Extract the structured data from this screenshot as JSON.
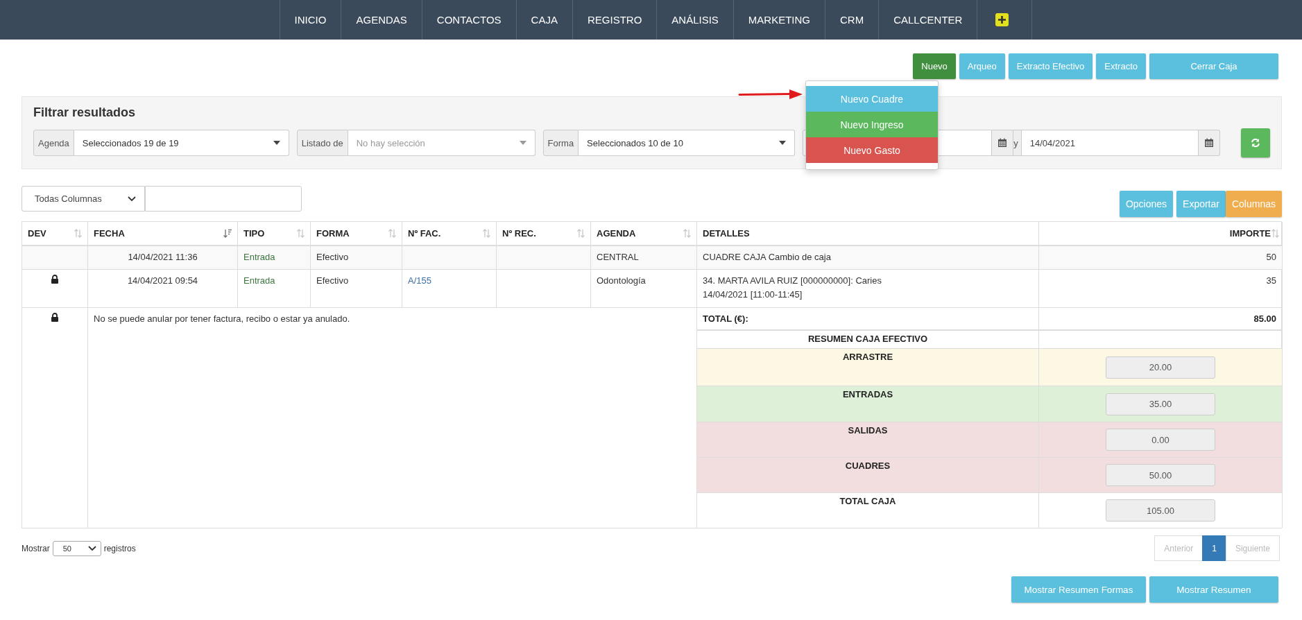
{
  "nav": {
    "items": [
      "INICIO",
      "AGENDAS",
      "CONTACTOS",
      "CAJA",
      "REGISTRO",
      "ANÁLISIS",
      "MARKETING",
      "CRM",
      "CALLCENTER"
    ]
  },
  "actions": [
    {
      "label": "Nuevo",
      "kind": "success"
    },
    {
      "label": "Arqueo",
      "kind": "info"
    },
    {
      "label": "Extracto Efectivo",
      "kind": "info"
    },
    {
      "label": "Extracto",
      "kind": "info"
    },
    {
      "label": "Cerrar Caja",
      "kind": "info"
    }
  ],
  "new_menu": [
    {
      "label": "Nuevo Cuadre",
      "kind": "info"
    },
    {
      "label": "Nuevo Ingreso",
      "kind": "success"
    },
    {
      "label": "Nuevo Gasto",
      "kind": "danger"
    }
  ],
  "filter": {
    "title": "Filtrar resultados",
    "selects": [
      {
        "addon": "Agenda",
        "value": "Seleccionados 19 de 19"
      },
      {
        "addon": "Listado de",
        "placeholder": "No hay selección"
      },
      {
        "addon": "Forma",
        "value": "Seleccionados 10 de 10"
      }
    ],
    "date_range": {
      "separator": "y",
      "end": "14/04/2021"
    }
  },
  "toolbar": {
    "column_select": "Todas Columnas",
    "buttons": [
      {
        "label": "Opciones",
        "kind": "info"
      },
      {
        "label": "Exportar",
        "kind": "info"
      },
      {
        "label": "Columnas",
        "kind": "warning"
      }
    ]
  },
  "table": {
    "columns": [
      {
        "label": "DEV",
        "kind": "sortable"
      },
      {
        "label": "FECHA",
        "kind": "sorted"
      },
      {
        "label": "TIPO",
        "kind": "sortable"
      },
      {
        "label": "FORMA",
        "kind": "sortable"
      },
      {
        "label": "Nº FAC.",
        "kind": "sortable"
      },
      {
        "label": "Nº REC.",
        "kind": "sortable"
      },
      {
        "label": "AGENDA",
        "kind": "sortable"
      },
      {
        "label": "DETALLES",
        "kind": "plain"
      },
      {
        "label": "IMPORTE",
        "kind": "sortable"
      }
    ],
    "rows": [
      {
        "locked": false,
        "fecha": "14/04/2021 11:36",
        "tipo": "Entrada",
        "forma": "Efectivo",
        "agenda": "CENTRAL",
        "detalles": [
          "CUADRE CAJA Cambio de caja"
        ],
        "importe": "50"
      },
      {
        "locked": true,
        "fecha": "14/04/2021 09:54",
        "tipo": "Entrada",
        "forma": "Efectivo",
        "n_fac": "A/155",
        "agenda": "Odontología",
        "detalles": [
          "34. MARTA AVILA RUIZ [000000000]: Caries",
          "14/04/2021 [11:00-11:45]"
        ],
        "importe": "35"
      }
    ],
    "note": {
      "locked": true,
      "message": "No se puede anular por tener factura, recibo o estar ya anulado."
    },
    "total": {
      "label": "TOTAL (€):",
      "value": "85.00"
    },
    "summary": {
      "title": "RESUMEN CAJA EFECTIVO",
      "rows": [
        {
          "label": "ARRASTRE",
          "value": "20.00",
          "kind": "warning"
        },
        {
          "label": "ENTRADAS",
          "value": "35.00",
          "kind": "success"
        },
        {
          "label": "SALIDAS",
          "value": "0.00",
          "kind": "danger"
        },
        {
          "label": "CUADRES",
          "value": "50.00",
          "kind": "danger"
        },
        {
          "label": "TOTAL CAJA",
          "value": "105.00",
          "kind": "plain"
        }
      ]
    }
  },
  "footer": {
    "length": {
      "prefix": "Mostrar",
      "value": "50",
      "suffix": "registros"
    },
    "pagination": [
      {
        "label": "Anterior",
        "disabled": true,
        "selected": false
      },
      {
        "label": "1",
        "disabled": false,
        "selected": true
      },
      {
        "label": "Siguiente",
        "disabled": true,
        "selected": false
      }
    ]
  },
  "bottom_buttons": [
    "Mostrar Resumen Formas",
    "Mostrar Resumen"
  ]
}
